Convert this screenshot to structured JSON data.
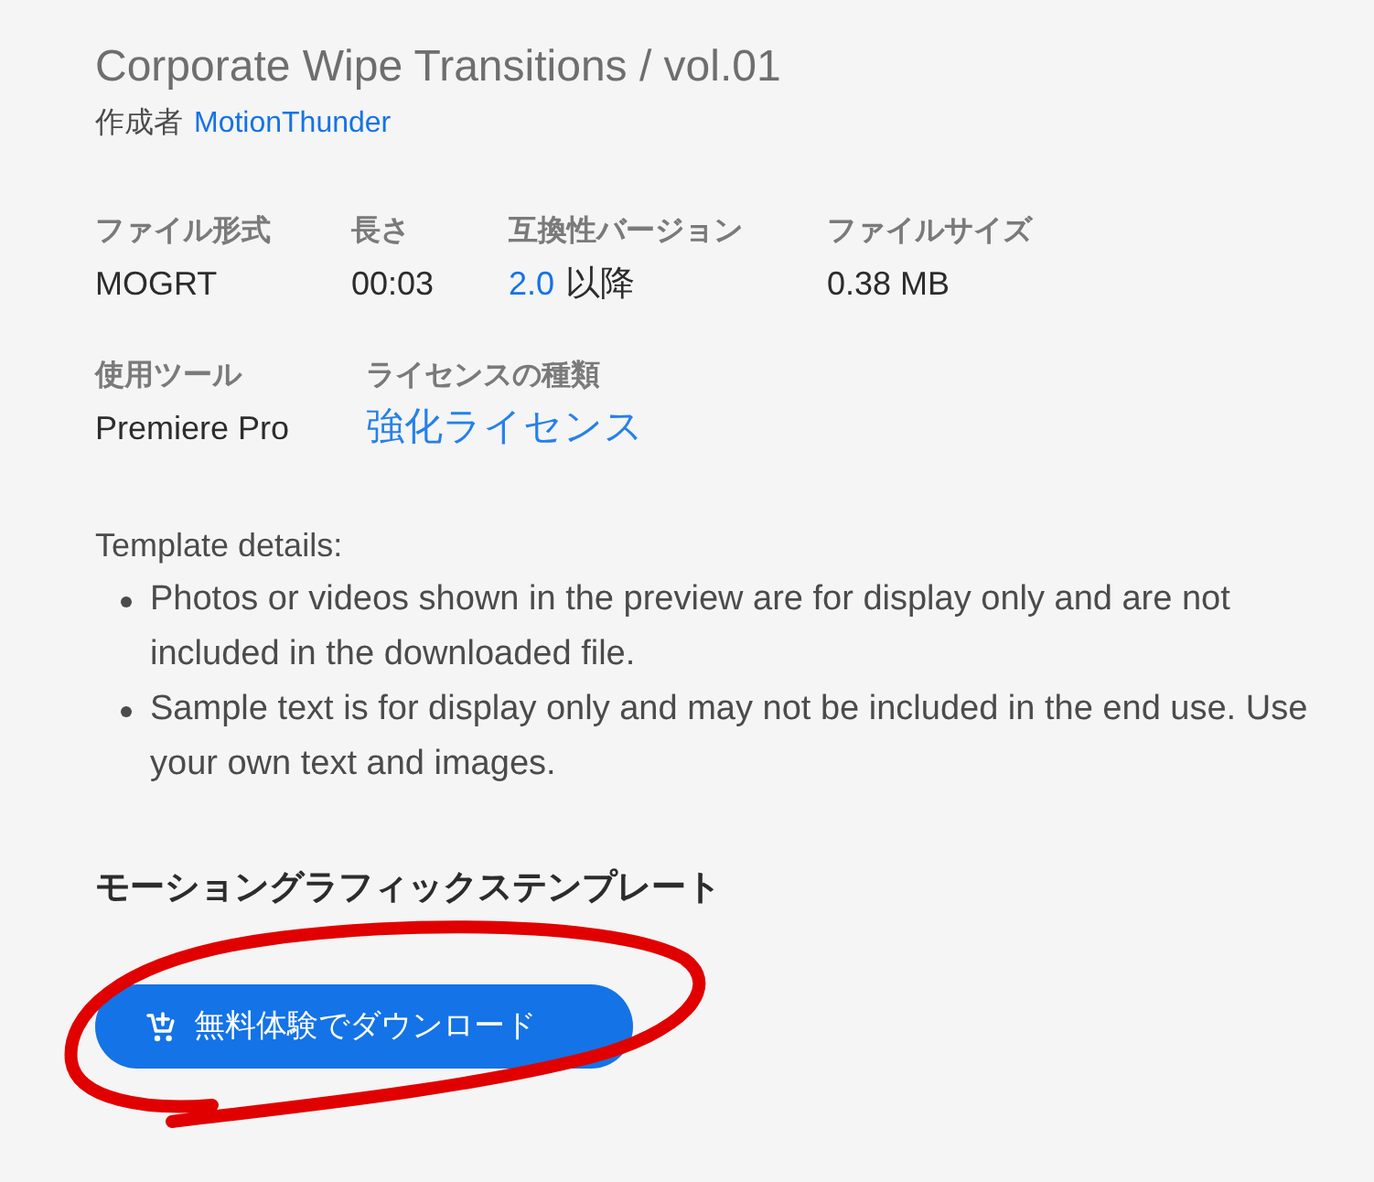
{
  "product": {
    "title": "Corporate Wipe Transitions / vol.01",
    "creator_label": "作成者",
    "creator": "MotionThunder"
  },
  "specs": [
    [
      {
        "label": "ファイル形式",
        "value": "MOGRT",
        "kind": "text"
      },
      {
        "label": "長さ",
        "value": "00:03",
        "kind": "text"
      },
      {
        "label": "互換性バージョン",
        "value": "2.0",
        "suffix": "以降",
        "kind": "version"
      },
      {
        "label": "ファイルサイズ",
        "value": "0.38 MB",
        "kind": "text"
      }
    ],
    [
      {
        "label": "使用ツール",
        "value": "Premiere Pro",
        "kind": "text"
      },
      {
        "label": "ライセンスの種類",
        "value": "強化ライセンス",
        "kind": "license"
      }
    ]
  ],
  "template_details": {
    "heading": "Template details:",
    "items": [
      "Photos or videos shown in the preview are for display only and are not included in the downloaded file.",
      "Sample text is for display only and may not be included in the end use. Use your own text and images."
    ]
  },
  "section_heading": "モーショングラフィックステンプレート",
  "download_button": {
    "label": "無料体験でダウンロード"
  },
  "annotation": {
    "kind": "loop"
  }
}
